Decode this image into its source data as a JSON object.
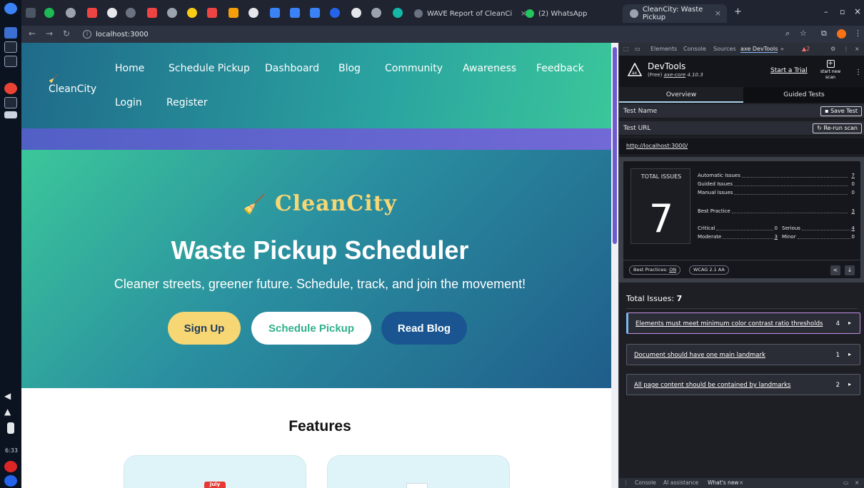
{
  "browser": {
    "tabs": [
      {
        "title": "WAVE Report of CleanCi",
        "active": false
      },
      {
        "title": "(2) WhatsApp",
        "active": false
      },
      {
        "title": "CleanCity: Waste Pickup",
        "active": true
      }
    ],
    "url": "localhost:3000",
    "new_tab_glyph": "+"
  },
  "os": {
    "clock": "6:33"
  },
  "site": {
    "brand": "CleanCity",
    "nav": [
      "Home",
      "Schedule Pickup",
      "Dashboard",
      "Blog",
      "Community",
      "Awareness",
      "Feedback",
      "Login",
      "Register"
    ],
    "hero": {
      "brand": "CleanCity",
      "title": "Waste Pickup Scheduler",
      "subtitle": "Cleaner streets, greener future. Schedule, track, and join the movement!",
      "buttons": {
        "signup": "Sign Up",
        "schedule": "Schedule Pickup",
        "blog": "Read Blog"
      }
    },
    "features_title": "Features",
    "calendar_label": "July"
  },
  "devtools": {
    "tabs": [
      "Elements",
      "Console",
      "Sources",
      "axe DevTools"
    ],
    "more": "»",
    "warning_count": "2",
    "axe": {
      "name": "DevTools",
      "version_prefix": "(Free)",
      "version_link": "axe-core",
      "version_num": "4.10.3",
      "start_trial": "Start a Trial",
      "start_new_scan": "start new scan",
      "overview_tab": "Overview",
      "guided_tab": "Guided Tests",
      "test_name_label": "Test Name",
      "save_test": "Save Test",
      "test_url_label": "Test URL",
      "rerun_scan": "Re-run scan",
      "test_url": "http://localhost:3000/",
      "summary": {
        "total_label": "TOTAL ISSUES",
        "total": "7",
        "automatic_label": "Automatic Issues",
        "automatic": "7",
        "guided_label": "Guided Issues",
        "guided": "0",
        "manual_label": "Manual Issues",
        "manual": "0",
        "best_practice_label": "Best Practice",
        "best_practice": "3",
        "critical_label": "Critical",
        "critical": "0",
        "serious_label": "Serious",
        "serious": "4",
        "moderate_label": "Moderate",
        "moderate": "3",
        "minor_label": "Minor",
        "minor": "0",
        "best_practices_pill_label": "Best Practices:",
        "best_practices_pill_value": "ON",
        "wcag_pill": "WCAG 2.1 AA"
      },
      "issues_heading_label": "Total Issues:",
      "issues_heading_count": "7",
      "issues": [
        {
          "title": "Elements must meet minimum color contrast ratio thresholds",
          "count": "4"
        },
        {
          "title": "Document should have one main landmark",
          "count": "1"
        },
        {
          "title": "All page content should be contained by landmarks",
          "count": "2"
        }
      ]
    },
    "drawer": {
      "console": "Console",
      "ai": "AI assistance",
      "whats_new": "What's new"
    }
  },
  "colors": {
    "header_from": "#1f6a8a",
    "header_to": "#3bc79a",
    "hero_accent": "#f7d774",
    "blog_button": "#1a5591",
    "devtools_bg": "#1d1f24",
    "selected_issue_border": "#c08fe8"
  }
}
